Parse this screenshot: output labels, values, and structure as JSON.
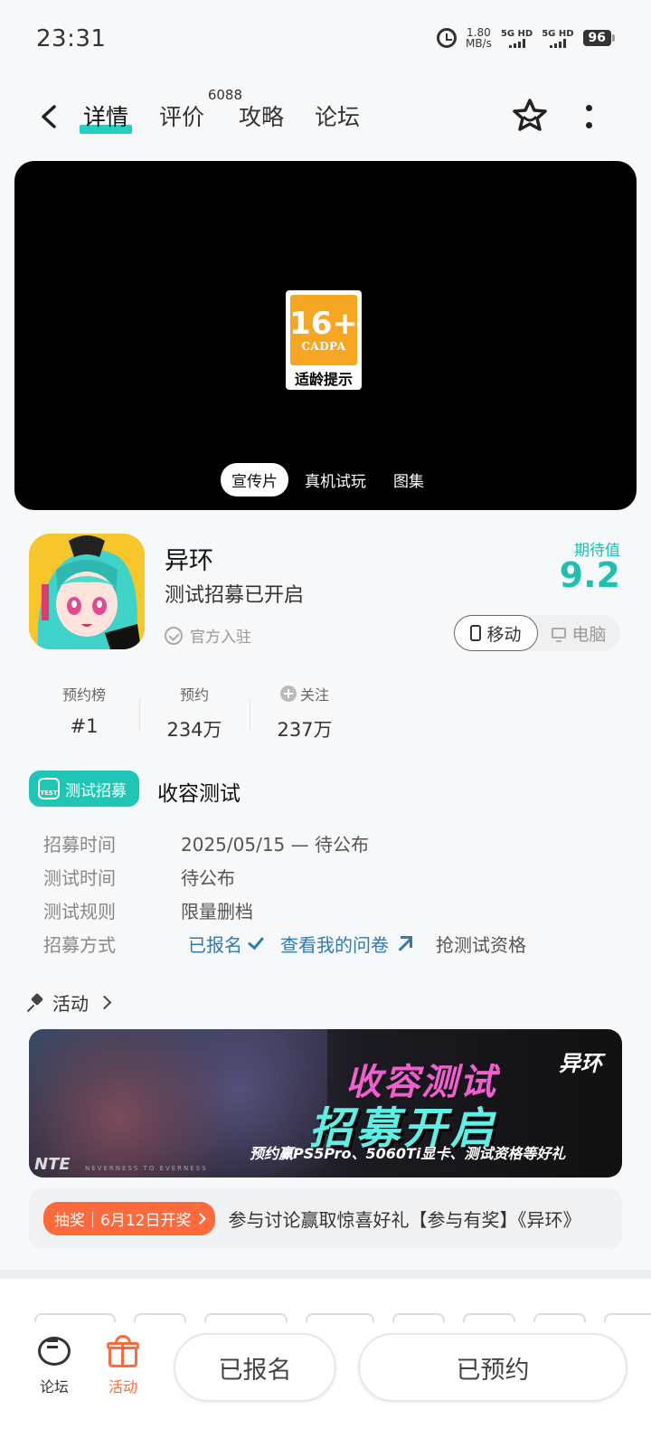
{
  "status": {
    "time": "23:31",
    "speed_value": "1.80",
    "speed_unit": "MB/s",
    "net1": "5G HD",
    "net2": "5G HD",
    "battery": "96"
  },
  "nav": {
    "tabs": [
      {
        "label": "详情",
        "active": true
      },
      {
        "label": "评价",
        "badge": "6088"
      },
      {
        "label": "攻略"
      },
      {
        "label": "论坛"
      }
    ]
  },
  "video": {
    "rating_age": "16+",
    "rating_org": "CADPA",
    "rating_hint": "适龄提示",
    "media_tabs": [
      "宣传片",
      "真机试玩",
      "图集"
    ]
  },
  "game": {
    "title": "异环",
    "subtitle": "测试招募已开启",
    "official": "官方入驻",
    "expect_label": "期待值",
    "expect_value": "9.2",
    "platforms": [
      "移动",
      "电脑"
    ]
  },
  "stats": [
    {
      "label": "预约榜",
      "value": "#1"
    },
    {
      "label": "预约",
      "value": "234万"
    },
    {
      "label": "关注",
      "value": "237万"
    }
  ],
  "recruit": {
    "badge": "测试招募",
    "badge_icon_text": "TEST",
    "title": "收容测试",
    "rows": [
      {
        "key": "招募时间",
        "value": "2025/05/15 — 待公布"
      },
      {
        "key": "测试时间",
        "value": "待公布"
      },
      {
        "key": "测试规则",
        "value": "限量删档"
      }
    ],
    "method_key": "招募方式",
    "method_signed": "已报名",
    "method_questionnaire": "查看我的问卷",
    "method_grab": "抢测试资格"
  },
  "activity": {
    "heading": "活动",
    "banner": {
      "logo": "异环",
      "line1": "收容测试",
      "line2": "招募开启",
      "line3": "预约赢PS5Pro、5060Ti显卡、测试资格等好礼",
      "brand": "NTE",
      "brand_sub": "NEVERNESS TO EVERNESS"
    },
    "lottery_tag": "抽奖｜6月12日开奖",
    "lottery_text": "参与讨论赢取惊喜好礼【参与有奖】《异环》"
  },
  "bottom": {
    "forum_label": "论坛",
    "activity_label": "活动",
    "signed_button": "已报名",
    "reserved_button": "已预约"
  },
  "colors": {
    "accent": "#1fc6b6",
    "orange": "#ff6a3c",
    "link": "#2f7bb4"
  }
}
